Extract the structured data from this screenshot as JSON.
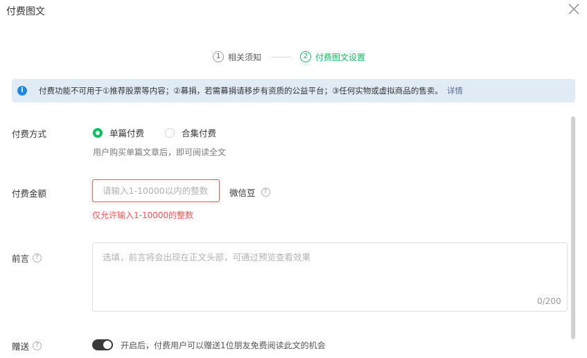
{
  "dialog": {
    "title": "付费图文",
    "close_icon": "close-icon"
  },
  "steps": [
    {
      "num": "1",
      "label": "相关须知",
      "active": false
    },
    {
      "num": "2",
      "label": "付费图文设置",
      "active": true
    }
  ],
  "notice": {
    "text": "付费功能不可用于①推荐股票等内容；②募捐，若需募捐请移步有资质的公益平台；③任何实物或虚拟商品的售卖。",
    "link": "详情",
    "icon": "info-icon"
  },
  "payment_method": {
    "label": "付费方式",
    "options": [
      {
        "label": "单篇付费",
        "selected": true
      },
      {
        "label": "合集付费",
        "selected": false
      }
    ],
    "hint": "用户购买单篇文章后，即可阅读全文"
  },
  "amount": {
    "label": "付费金额",
    "placeholder": "请输入1-10000以内的整数",
    "value": "",
    "unit": "微信豆",
    "error": "仅允许输入1-10000的整数"
  },
  "preface": {
    "label": "前言",
    "placeholder": "选填，前言将会出现在正文头部，可通过预览查看效果",
    "counter": "0/200"
  },
  "gift": {
    "label": "赠送",
    "toggle_on": false,
    "hint": "开启后，付费用户可以赠送1位朋友免费阅读此文的机会"
  },
  "colors": {
    "accent": "#07c160",
    "error": "#fa5151",
    "notice_bg": "#e1ebf6",
    "link": "#576b95"
  }
}
